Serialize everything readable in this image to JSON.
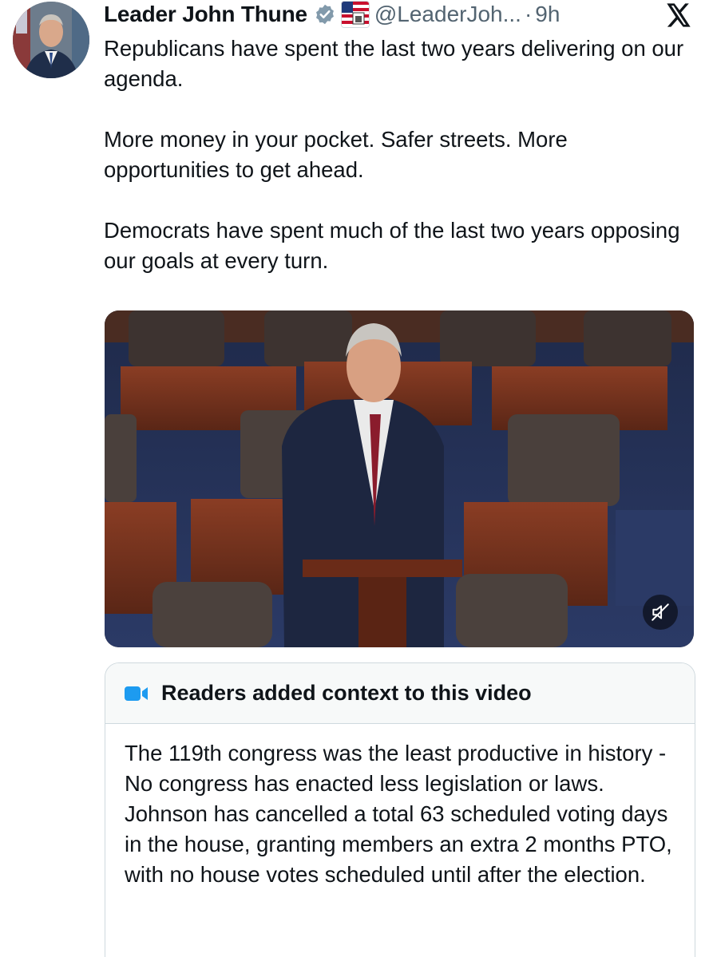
{
  "tweet": {
    "display_name": "Leader John Thune",
    "handle": "@LeaderJoh...",
    "separator": "·",
    "time": "9h",
    "paragraphs": [
      "Republicans have spent the last two years delivering on our agenda.",
      "More money in your pocket. Safer streets. More opportunities to get ahead.",
      "Democrats have spent much of the last two years opposing our goals at every turn."
    ]
  },
  "icons": {
    "verified": "verified-badge-icon",
    "affiliation": "us-senate-flag-icon",
    "platform": "x-logo-icon",
    "mute": "muted-speaker-icon",
    "note": "community-notes-icon"
  },
  "community_note": {
    "title": "Readers added context to this video",
    "body": "The 119th congress was the least productive in history - No congress has enacted less legislation or laws. Johnson has cancelled a total 63 scheduled voting days in the house, granting members an extra 2 months PTO, with no house votes scheduled until after the election."
  },
  "colors": {
    "text_primary": "#0f1419",
    "text_secondary": "#536471",
    "border": "#cfd9de",
    "note_header_bg": "#f7f9f9",
    "verified_badge": "#829aab",
    "note_icon": "#1d9bf0"
  }
}
